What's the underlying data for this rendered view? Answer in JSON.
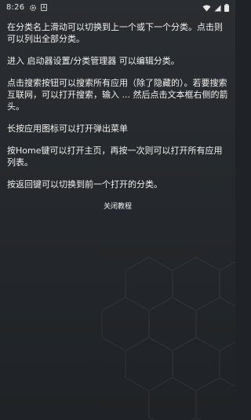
{
  "status_bar": {
    "time": "8:26",
    "gear_icon": "gear-icon",
    "a_icon_text": "A"
  },
  "tutorial": {
    "paragraphs": [
      "在分类名上滑动可以切换到上一个或下一个分类。点击则可以列出全部分类。",
      "进入 启动器设置/分类管理器 可以编辑分类。",
      "点击搜索按钮可以搜索所有应用（除了隐藏的）。若要搜索互联网，可以打开搜索，输入 ... 然后点击文本框右侧的箭头。",
      "长按应用图标可以打开弹出菜单",
      "按Home键可以打开主页，再按一次则可以打开所有应用列表。",
      "按返回键可以切换到前一个打开的分类。"
    ],
    "close_label": "关闭教程"
  }
}
